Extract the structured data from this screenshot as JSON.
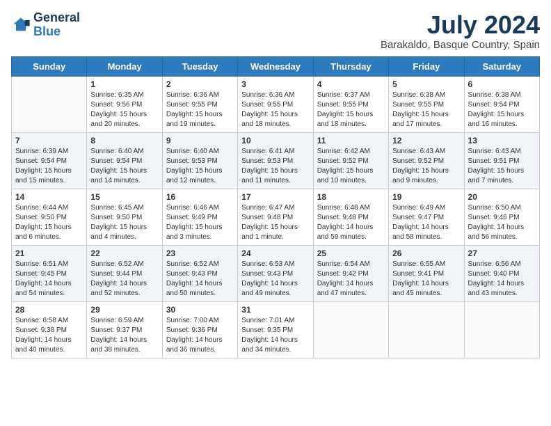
{
  "header": {
    "logo_line1": "General",
    "logo_line2": "Blue",
    "month": "July 2024",
    "location": "Barakaldo, Basque Country, Spain"
  },
  "weekdays": [
    "Sunday",
    "Monday",
    "Tuesday",
    "Wednesday",
    "Thursday",
    "Friday",
    "Saturday"
  ],
  "weeks": [
    [
      {
        "day": "",
        "info": ""
      },
      {
        "day": "1",
        "info": "Sunrise: 6:35 AM\nSunset: 9:56 PM\nDaylight: 15 hours\nand 20 minutes."
      },
      {
        "day": "2",
        "info": "Sunrise: 6:36 AM\nSunset: 9:55 PM\nDaylight: 15 hours\nand 19 minutes."
      },
      {
        "day": "3",
        "info": "Sunrise: 6:36 AM\nSunset: 9:55 PM\nDaylight: 15 hours\nand 18 minutes."
      },
      {
        "day": "4",
        "info": "Sunrise: 6:37 AM\nSunset: 9:55 PM\nDaylight: 15 hours\nand 18 minutes."
      },
      {
        "day": "5",
        "info": "Sunrise: 6:38 AM\nSunset: 9:55 PM\nDaylight: 15 hours\nand 17 minutes."
      },
      {
        "day": "6",
        "info": "Sunrise: 6:38 AM\nSunset: 9:54 PM\nDaylight: 15 hours\nand 16 minutes."
      }
    ],
    [
      {
        "day": "7",
        "info": "Sunrise: 6:39 AM\nSunset: 9:54 PM\nDaylight: 15 hours\nand 15 minutes."
      },
      {
        "day": "8",
        "info": "Sunrise: 6:40 AM\nSunset: 9:54 PM\nDaylight: 15 hours\nand 14 minutes."
      },
      {
        "day": "9",
        "info": "Sunrise: 6:40 AM\nSunset: 9:53 PM\nDaylight: 15 hours\nand 12 minutes."
      },
      {
        "day": "10",
        "info": "Sunrise: 6:41 AM\nSunset: 9:53 PM\nDaylight: 15 hours\nand 11 minutes."
      },
      {
        "day": "11",
        "info": "Sunrise: 6:42 AM\nSunset: 9:52 PM\nDaylight: 15 hours\nand 10 minutes."
      },
      {
        "day": "12",
        "info": "Sunrise: 6:43 AM\nSunset: 9:52 PM\nDaylight: 15 hours\nand 9 minutes."
      },
      {
        "day": "13",
        "info": "Sunrise: 6:43 AM\nSunset: 9:51 PM\nDaylight: 15 hours\nand 7 minutes."
      }
    ],
    [
      {
        "day": "14",
        "info": "Sunrise: 6:44 AM\nSunset: 9:50 PM\nDaylight: 15 hours\nand 6 minutes."
      },
      {
        "day": "15",
        "info": "Sunrise: 6:45 AM\nSunset: 9:50 PM\nDaylight: 15 hours\nand 4 minutes."
      },
      {
        "day": "16",
        "info": "Sunrise: 6:46 AM\nSunset: 9:49 PM\nDaylight: 15 hours\nand 3 minutes."
      },
      {
        "day": "17",
        "info": "Sunrise: 6:47 AM\nSunset: 9:48 PM\nDaylight: 15 hours\nand 1 minute."
      },
      {
        "day": "18",
        "info": "Sunrise: 6:48 AM\nSunset: 9:48 PM\nDaylight: 14 hours\nand 59 minutes."
      },
      {
        "day": "19",
        "info": "Sunrise: 6:49 AM\nSunset: 9:47 PM\nDaylight: 14 hours\nand 58 minutes."
      },
      {
        "day": "20",
        "info": "Sunrise: 6:50 AM\nSunset: 9:46 PM\nDaylight: 14 hours\nand 56 minutes."
      }
    ],
    [
      {
        "day": "21",
        "info": "Sunrise: 6:51 AM\nSunset: 9:45 PM\nDaylight: 14 hours\nand 54 minutes."
      },
      {
        "day": "22",
        "info": "Sunrise: 6:52 AM\nSunset: 9:44 PM\nDaylight: 14 hours\nand 52 minutes."
      },
      {
        "day": "23",
        "info": "Sunrise: 6:52 AM\nSunset: 9:43 PM\nDaylight: 14 hours\nand 50 minutes."
      },
      {
        "day": "24",
        "info": "Sunrise: 6:53 AM\nSunset: 9:43 PM\nDaylight: 14 hours\nand 49 minutes."
      },
      {
        "day": "25",
        "info": "Sunrise: 6:54 AM\nSunset: 9:42 PM\nDaylight: 14 hours\nand 47 minutes."
      },
      {
        "day": "26",
        "info": "Sunrise: 6:55 AM\nSunset: 9:41 PM\nDaylight: 14 hours\nand 45 minutes."
      },
      {
        "day": "27",
        "info": "Sunrise: 6:56 AM\nSunset: 9:40 PM\nDaylight: 14 hours\nand 43 minutes."
      }
    ],
    [
      {
        "day": "28",
        "info": "Sunrise: 6:58 AM\nSunset: 9:38 PM\nDaylight: 14 hours\nand 40 minutes."
      },
      {
        "day": "29",
        "info": "Sunrise: 6:59 AM\nSunset: 9:37 PM\nDaylight: 14 hours\nand 38 minutes."
      },
      {
        "day": "30",
        "info": "Sunrise: 7:00 AM\nSunset: 9:36 PM\nDaylight: 14 hours\nand 36 minutes."
      },
      {
        "day": "31",
        "info": "Sunrise: 7:01 AM\nSunset: 9:35 PM\nDaylight: 14 hours\nand 34 minutes."
      },
      {
        "day": "",
        "info": ""
      },
      {
        "day": "",
        "info": ""
      },
      {
        "day": "",
        "info": ""
      }
    ]
  ]
}
